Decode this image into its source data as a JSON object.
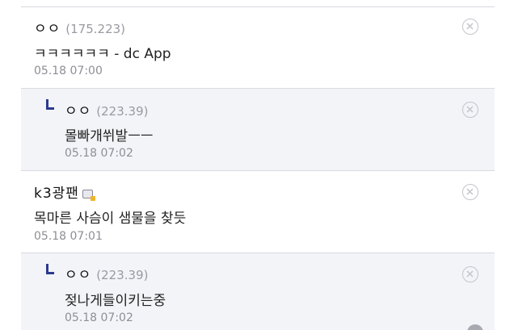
{
  "comments": [
    {
      "nickname": "ㅇㅇ",
      "ip": "(175.223)",
      "text": "ㅋㅋㅋㅋㅋㅋ - dc App",
      "time": "05.18 07:00",
      "is_reply": false
    },
    {
      "nickname": "ㅇㅇ",
      "ip": "(223.39)",
      "text": "몰빠개쒸발ㅡㅡ",
      "time": "05.18 07:02",
      "is_reply": true
    },
    {
      "nickname": "k3광팬",
      "ip": "",
      "text": "목마른 사슴이 샘물을 찾듯",
      "time": "05.18 07:01",
      "is_reply": false,
      "badge_icon": "fixed-nick-icon"
    },
    {
      "nickname": "ㅇㅇ",
      "ip": "(223.39)",
      "text": "젖나게들이키는중",
      "time": "05.18 07:02",
      "is_reply": true
    }
  ],
  "icons": {
    "delete": "close-circle-icon",
    "reply": "reply-arrow-icon"
  },
  "colors": {
    "reply_background": "#f3f4f8",
    "reply_mark": "#2b3a8f",
    "ip_text": "#9a9aa2",
    "divider": "#d9d9e0"
  }
}
